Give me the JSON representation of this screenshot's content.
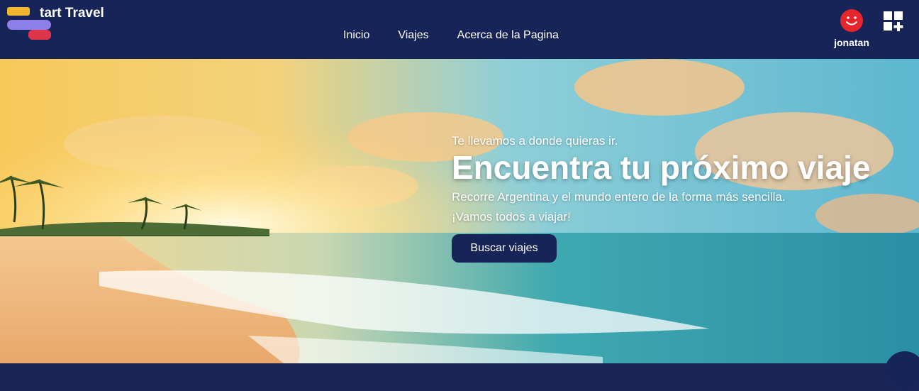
{
  "header": {
    "logo_text": "tart Travel",
    "nav": [
      {
        "label": "Inicio"
      },
      {
        "label": "Viajes"
      },
      {
        "label": "Acerca de la Pagina"
      }
    ],
    "user": {
      "name": "jonatan",
      "icon": "smiley-avatar-icon"
    },
    "apps_icon": "grid-plus-icon"
  },
  "hero": {
    "tagline": "Te llevamos a donde quieras ir.",
    "headline": "Encuentra tu próximo viaje",
    "description_line1": "Recorre Argentina y el mundo entero de la forma más sencilla.",
    "description_line2": "¡Vamos todos a viajar!",
    "cta_label": "Buscar viajes",
    "background": "beach-sunset-image"
  },
  "colors": {
    "navbar": "#172457",
    "accent_yellow": "#f2b62f",
    "accent_purple": "#8e7fe8",
    "accent_red": "#e0344a",
    "button": "#172457"
  }
}
